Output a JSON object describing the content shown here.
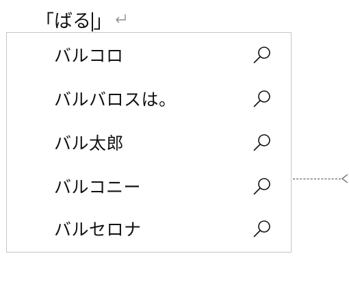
{
  "composition": {
    "open_bracket": "「",
    "composing_text": "ばる",
    "close_bracket": "」"
  },
  "candidates": [
    {
      "label": "バルコロ",
      "icon": "search-icon"
    },
    {
      "label": "バルバロスは。",
      "icon": "search-icon"
    },
    {
      "label": "バル太郎",
      "icon": "search-icon"
    },
    {
      "label": "バルコニー",
      "icon": "search-icon"
    },
    {
      "label": "バルセロナ",
      "icon": "search-icon"
    }
  ],
  "colors": {
    "border": "#c4c4c4",
    "text": "#111111",
    "return_mark": "#8a8a8a"
  }
}
